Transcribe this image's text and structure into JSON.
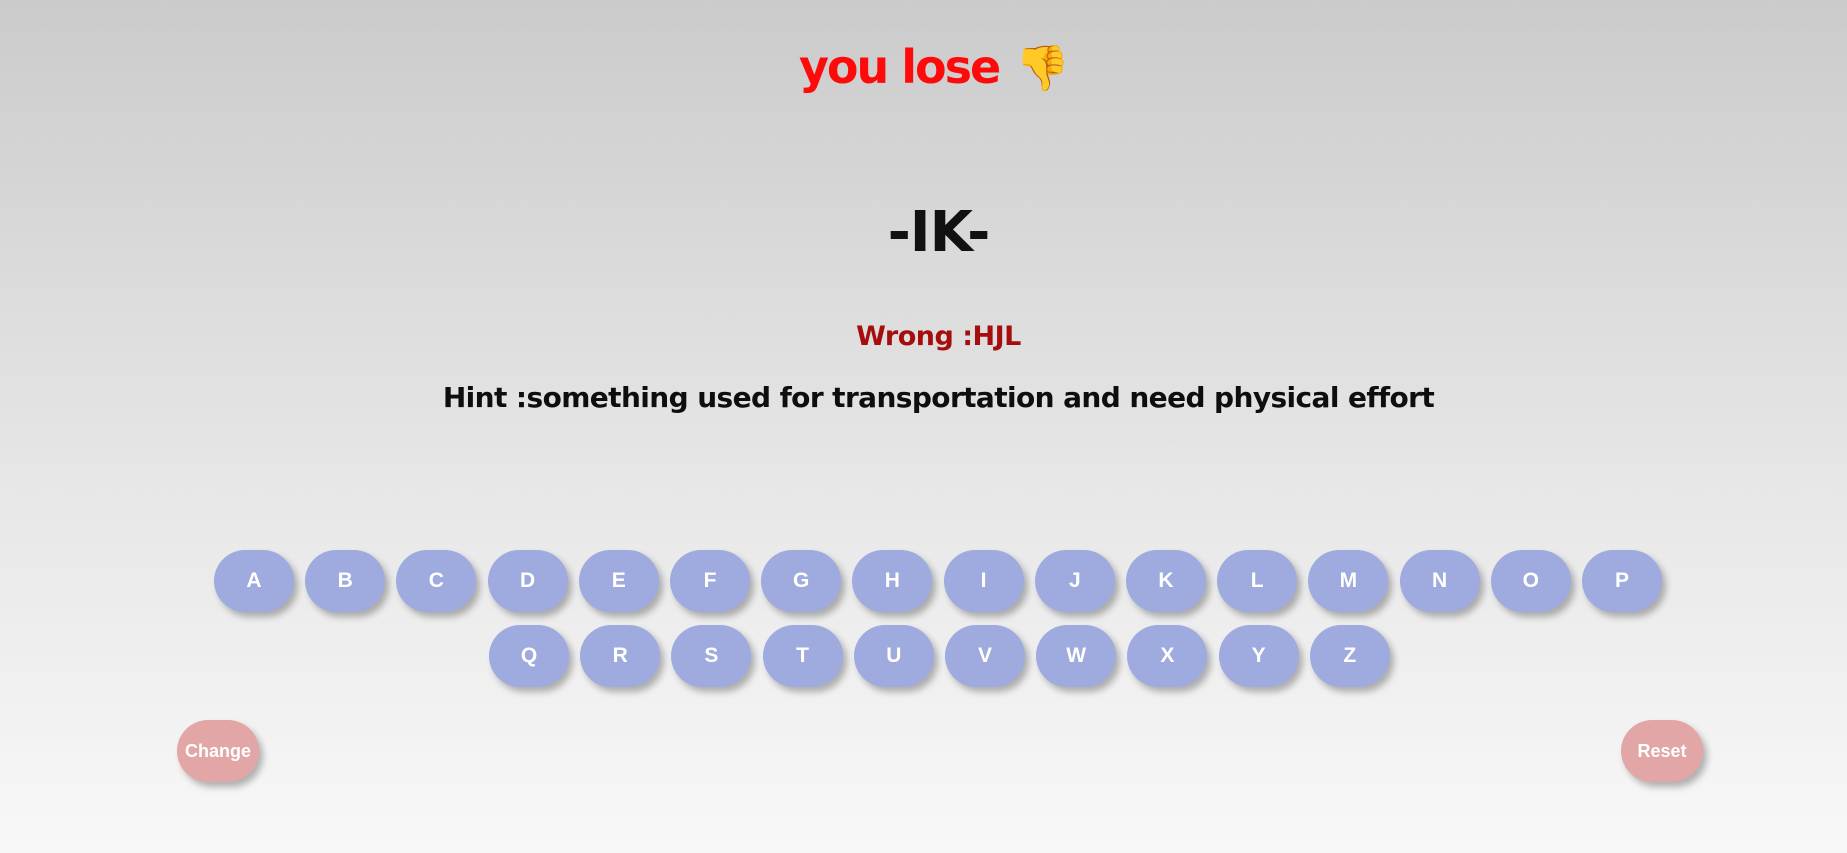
{
  "status": {
    "text": "you lose",
    "icon": "thumbs-down-icon",
    "icon_glyph": "👎",
    "color": "#ff0a0a"
  },
  "word_display": "-IK-",
  "wrong": {
    "text": "Wrong :HJL",
    "color": "#a60d0d"
  },
  "hint": {
    "text": "Hint :something used for transportation and need physical effort"
  },
  "keyboard": {
    "row1": [
      "A",
      "B",
      "C",
      "D",
      "E",
      "F",
      "G",
      "H",
      "I",
      "J",
      "K",
      "L",
      "M",
      "N",
      "O",
      "P"
    ],
    "row2": [
      "Q",
      "R",
      "S",
      "T",
      "U",
      "V",
      "W",
      "X",
      "Y",
      "Z"
    ],
    "key_color": "#9fabdf"
  },
  "controls": {
    "change_label": "Change",
    "reset_label": "Reset",
    "button_color": "#e2a6a6"
  }
}
